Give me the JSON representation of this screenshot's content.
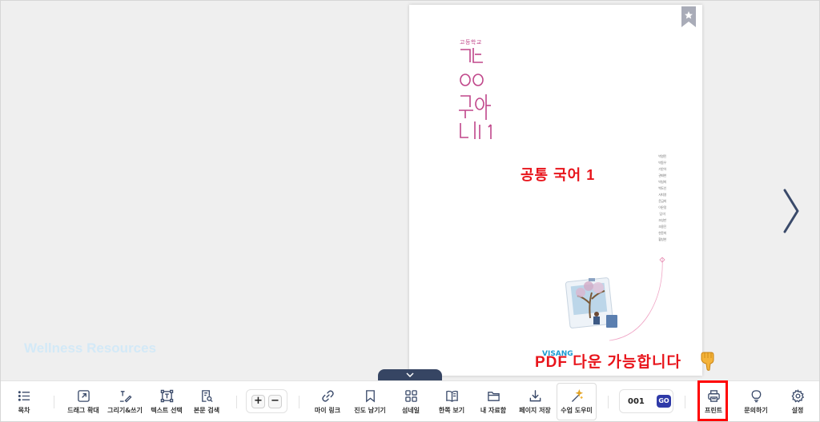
{
  "cover": {
    "grade": "고등학교",
    "title": "공통 국어 1",
    "authors": [
      "박영민",
      "박동우",
      "가은아",
      "권태현",
      "박성희",
      "백도인",
      "서지영",
      "윤금희",
      "이은정",
      "임 미",
      "조성만",
      "조용진",
      "한준희",
      "황성현"
    ],
    "publisher": "VISANG"
  },
  "captions": {
    "title_caption": "공통 국어 1",
    "pdf_caption": "PDF 다운 가능합니다"
  },
  "watermark": "Wellness Resources",
  "toolbar": {
    "toc": "목차",
    "drag_zoom": "드래그 확대",
    "draw_write": "그리기&쓰기",
    "text_select": "텍스트 선택",
    "text_search": "본문 검색",
    "zoom_in": "+",
    "zoom_out": "−",
    "my_link": "마이 링크",
    "progress_bookmark": "진도 남기기",
    "thumbnail": "섬네일",
    "single_view": "한쪽 보기",
    "my_library": "내 자료함",
    "save_page": "페이지 저장",
    "class_helper": "수업 도우미",
    "page_number": "001",
    "go": "GO",
    "print": "프린트",
    "inquiry": "문의하기",
    "settings": "설정"
  },
  "icons": {
    "toc": "list-icon",
    "drag_zoom": "expand-icon",
    "draw_write": "pen-icon",
    "text_select": "text-box-icon",
    "text_search": "document-search-icon",
    "my_link": "link-icon",
    "progress_bookmark": "bookmark-icon",
    "thumbnail": "grid-icon",
    "single_view": "book-icon",
    "my_library": "folder-icon",
    "save_page": "download-icon",
    "class_helper": "magic-wand-icon",
    "print": "printer-icon",
    "inquiry": "lightbulb-icon",
    "settings": "gear-icon",
    "next": "chevron-right-icon",
    "collapse": "chevron-down-icon"
  },
  "colors": {
    "accent": "#2f3aa8",
    "highlight": "#ff0000",
    "caption": "#e8141b",
    "cover_title": "#c0468a",
    "tab": "#364563"
  }
}
